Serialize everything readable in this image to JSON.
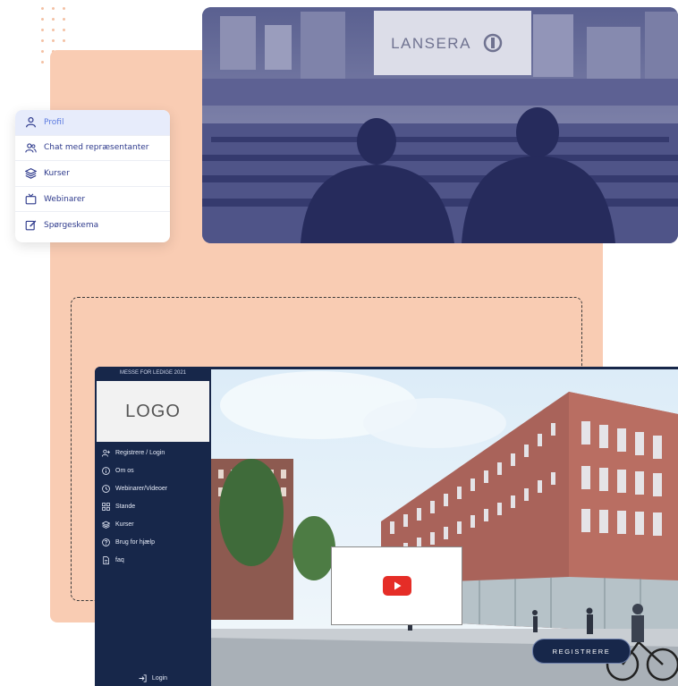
{
  "profile_menu": {
    "items": [
      {
        "label": "Profil",
        "icon": "user-icon",
        "active": true
      },
      {
        "label": "Chat med repræsentanter",
        "icon": "users-icon",
        "active": false
      },
      {
        "label": "Kurser",
        "icon": "layers-icon",
        "active": false
      },
      {
        "label": "Webinarer",
        "icon": "tv-icon",
        "active": false
      },
      {
        "label": "Spørgeskema",
        "icon": "edit-icon",
        "active": false
      }
    ]
  },
  "hero_photo": {
    "screen_text": "LANSERA"
  },
  "app": {
    "title": "MESSE FOR LEDIGE 2021",
    "logo_text": "LOGO",
    "sidebar": {
      "items": [
        {
          "label": "Registrere / Login",
          "icon": "user-plus-icon"
        },
        {
          "label": "Om os",
          "icon": "info-icon"
        },
        {
          "label": "Webinarer/Videoer",
          "icon": "clock-icon"
        },
        {
          "label": "Stande",
          "icon": "grid-icon"
        },
        {
          "label": "Kurser",
          "icon": "layers-icon"
        },
        {
          "label": "Brug for hjælp",
          "icon": "help-icon"
        },
        {
          "label": "faq",
          "icon": "file-icon"
        }
      ],
      "login_label": "Login"
    },
    "register_button": "REGISTRERE"
  },
  "colors": {
    "peach": "#f9ccb3",
    "navy": "#17274a",
    "accent_blue": "#2e3a8c",
    "active_bg": "#e7ecfb",
    "youtube_red": "#e52d27"
  }
}
